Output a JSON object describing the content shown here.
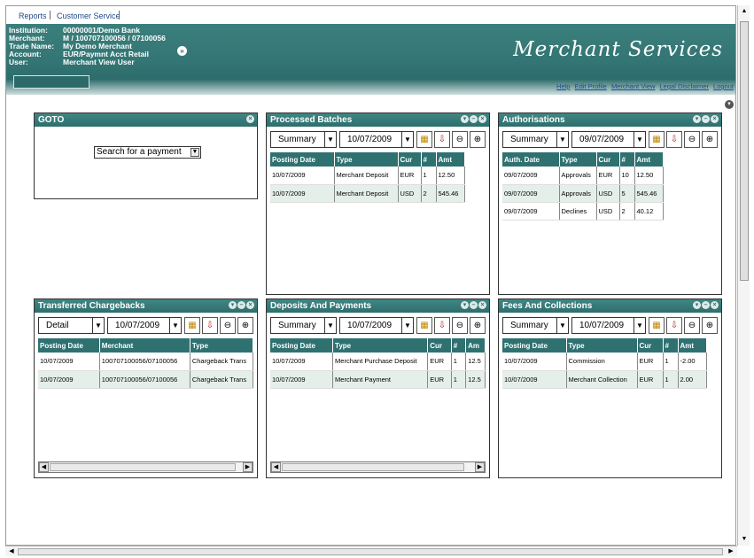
{
  "nav": {
    "reports": "Reports",
    "customer_service": "Customer Service"
  },
  "header": {
    "institution_label": "Institution:",
    "institution_value": "00000001/Demo Bank",
    "merchant_label": "Merchant:",
    "merchant_value": "M / 100707100056 / 07100056",
    "trade_name_label": "Trade Name:",
    "trade_name_value": "My Demo Merchant",
    "account_label": "Account:",
    "account_value": "EUR/Paymnt Acct Retail",
    "user_label": "User:",
    "user_value": "Merchant View User",
    "brand": "Merchant Services",
    "links": [
      "Help",
      "Edit Profile",
      "Merchant View",
      "Legal Disclaimer",
      "Logout"
    ]
  },
  "goto": {
    "title": "GOTO",
    "select_value": "Search for a payment"
  },
  "processed_batches": {
    "title": "Processed Batches",
    "view": "Summary",
    "date": "10/07/2009",
    "columns": [
      "Posting Date",
      "Type",
      "Cur",
      "#",
      "Amt"
    ],
    "rows": [
      [
        "10/07/2009",
        "Merchant Deposit",
        "EUR",
        "1",
        "12.50"
      ],
      [
        "10/07/2009",
        "Merchant Deposit",
        "USD",
        "2",
        "545.46"
      ]
    ]
  },
  "authorisations": {
    "title": "Authorisations",
    "view": "Summary",
    "date": "09/07/2009",
    "columns": [
      "Auth. Date",
      "Type",
      "Cur",
      "#",
      "Amt"
    ],
    "rows": [
      [
        "09/07/2009",
        "Approvals",
        "EUR",
        "10",
        "12.50"
      ],
      [
        "09/07/2009",
        "Approvals",
        "USD",
        "5",
        "545.46"
      ],
      [
        "09/07/2009",
        "Declines",
        "USD",
        "2",
        "40.12"
      ]
    ]
  },
  "transferred_chargebacks": {
    "title": "Transferred Chargebacks",
    "view": "Detail",
    "date": "10/07/2009",
    "columns": [
      "Posting Date",
      "Merchant",
      "Type"
    ],
    "rows": [
      [
        "10/07/2009",
        "100707100056/07100056",
        "Chargeback Trans"
      ],
      [
        "10/07/2009",
        "100707100056/07100056",
        "Chargeback Trans"
      ]
    ]
  },
  "deposits_payments": {
    "title": "Deposits And Payments",
    "view": "Summary",
    "date": "10/07/2009",
    "columns": [
      "Posting Date",
      "Type",
      "Cur",
      "#",
      "Am"
    ],
    "rows": [
      [
        "10/07/2009",
        "Merchant Purchase Deposit",
        "EUR",
        "1",
        "12.5"
      ],
      [
        "10/07/2009",
        "Merchant Payment",
        "EUR",
        "1",
        "12.5"
      ]
    ]
  },
  "fees_collections": {
    "title": "Fees And Collections",
    "view": "Summary",
    "date": "10/07/2009",
    "columns": [
      "Posting Date",
      "Type",
      "Cur",
      "#",
      "Amt"
    ],
    "rows": [
      [
        "10/07/2009",
        "Commission",
        "EUR",
        "1",
        "-2.00"
      ],
      [
        "10/07/2009",
        "Merchant Collection",
        "EUR",
        "1",
        "2.00"
      ]
    ]
  },
  "colors": {
    "teal": "#2f7170",
    "row_alt": "#e5efe9",
    "link": "#1d4b8a"
  }
}
